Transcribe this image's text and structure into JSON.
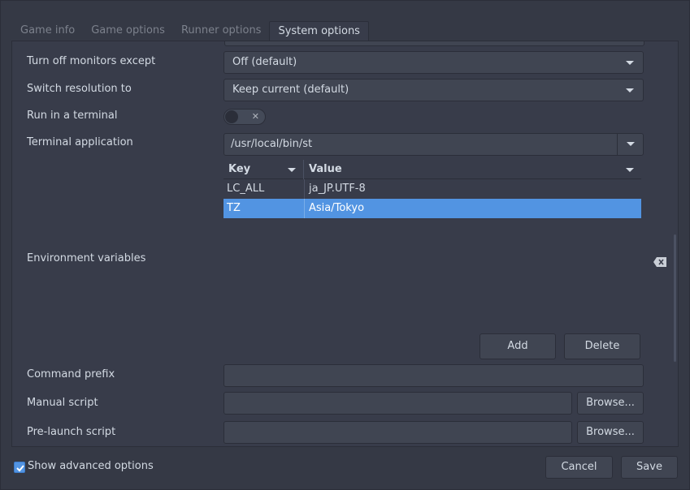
{
  "tabs": [
    {
      "label": "Game info",
      "active": false
    },
    {
      "label": "Game options",
      "active": false
    },
    {
      "label": "Runner options",
      "active": false
    },
    {
      "label": "System options",
      "active": true
    }
  ],
  "fields": {
    "turn_off_monitors": {
      "label": "Turn off monitors except",
      "value": "Off (default)"
    },
    "switch_resolution": {
      "label": "Switch resolution to",
      "value": "Keep current (default)"
    },
    "run_in_terminal": {
      "label": "Run in a terminal",
      "enabled": false
    },
    "terminal_application": {
      "label": "Terminal application",
      "value": "/usr/local/bin/st"
    },
    "environment_variables": {
      "label": "Environment variables",
      "columns": [
        "Key",
        "Value"
      ],
      "rows": [
        {
          "key": "LC_ALL",
          "value": "ja_JP.UTF-8",
          "selected": false
        },
        {
          "key": "TZ",
          "value": "Asia/Tokyo",
          "selected": true
        }
      ],
      "add_label": "Add",
      "delete_label": "Delete"
    },
    "command_prefix": {
      "label": "Command prefix",
      "value": ""
    },
    "manual_script": {
      "label": "Manual script",
      "value": "",
      "browse_label": "Browse..."
    },
    "pre_launch_script": {
      "label": "Pre-launch script",
      "value": "",
      "browse_label": "Browse..."
    }
  },
  "footer": {
    "show_advanced_label": "Show advanced options",
    "show_advanced_checked": true,
    "cancel_label": "Cancel",
    "save_label": "Save"
  },
  "colors": {
    "background": "#353945",
    "panel": "#383c4a",
    "accent": "#5294e2",
    "text": "#d3dae3"
  }
}
